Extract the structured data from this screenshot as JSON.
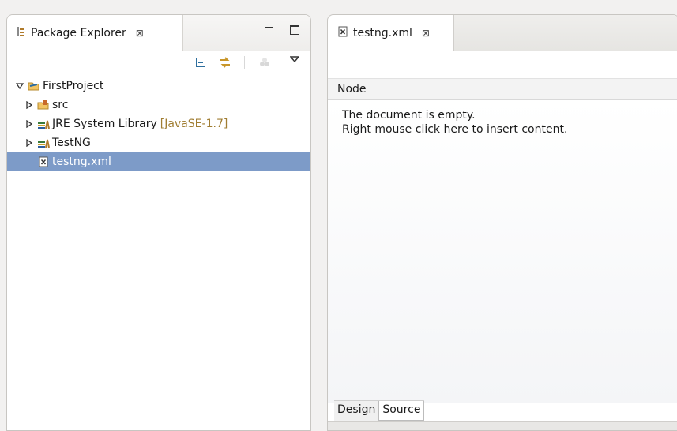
{
  "package_explorer": {
    "title": "Package Explorer",
    "close_glyph": "⊠",
    "icons": [
      "package-explorer-icon",
      "collapse-all-icon",
      "link-with-editor-icon",
      "focus-icon",
      "view-menu-icon",
      "minimize-icon",
      "maximize-icon"
    ],
    "tree": [
      {
        "label": "FirstProject",
        "level": 0,
        "expanded": true,
        "icon": "project-folder-icon"
      },
      {
        "label": "src",
        "level": 1,
        "expanded": false,
        "icon": "source-folder-icon"
      },
      {
        "label": "JRE System Library",
        "decoration": "[JavaSE-1.7]",
        "level": 1,
        "expanded": false,
        "icon": "library-icon"
      },
      {
        "label": "TestNG",
        "level": 1,
        "expanded": false,
        "icon": "library-icon"
      },
      {
        "label": "testng.xml",
        "level": 1,
        "selected": true,
        "icon": "xml-file-icon"
      }
    ]
  },
  "editor": {
    "tab_label": "testng.xml",
    "close_glyph": "⊠",
    "node_header": "Node",
    "empty_line1": "The document is empty.",
    "empty_line2": "Right mouse click here to insert content.",
    "tabs": [
      "Design",
      "Source"
    ]
  },
  "colors": {
    "selection": "#7d9bc8",
    "decoration": "#a07d32"
  }
}
